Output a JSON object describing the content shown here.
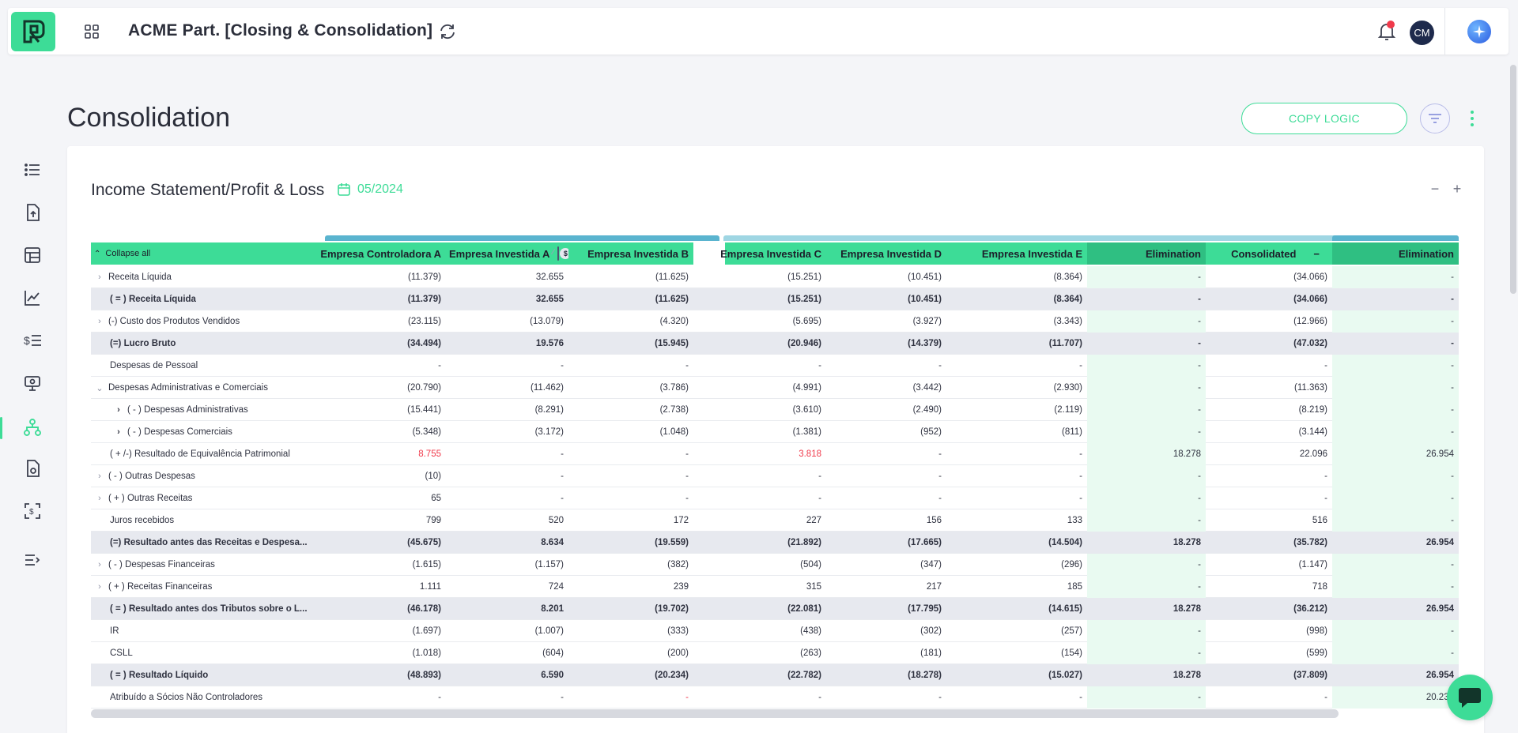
{
  "app": {
    "title": "ACME Part. [Closing & Consolidation]",
    "avatar_initials": "CM"
  },
  "page": {
    "title": "Consolidation",
    "copy_logic_label": "COPY LOGIC"
  },
  "card": {
    "title": "Income Statement/Profit & Loss",
    "date": "05/2024",
    "collapse_symbol": "−",
    "expand_symbol": "+"
  },
  "table": {
    "collapse_all_label": "Collapse all",
    "currency_toggle_symbol": "$",
    "currency_toggle_off_symbol": "⁄",
    "columns": [
      "Empresa Controladora A",
      "Empresa Investida A",
      "Empresa Investida B",
      "Empresa Investida C",
      "Empresa Investida D",
      "Empresa Investida E",
      "Elimination",
      "Consolidated",
      "Elimination"
    ],
    "consolidated_collapse_symbol": "−",
    "rows": [
      {
        "label": "Receita Líquida",
        "chevron": "›",
        "indent": 0,
        "bold": false,
        "values": [
          "(11.379)",
          "32.655",
          "(11.625)",
          "(15.251)",
          "(10.451)",
          "(8.364)",
          "-",
          "(34.066)",
          "-"
        ]
      },
      {
        "label": "( = ) Receita Líquida",
        "chevron": "",
        "indent": 1,
        "bold": true,
        "values": [
          "(11.379)",
          "32.655",
          "(11.625)",
          "(15.251)",
          "(10.451)",
          "(8.364)",
          "-",
          "(34.066)",
          "-"
        ]
      },
      {
        "label": "(-) Custo dos Produtos Vendidos",
        "chevron": "›",
        "indent": 0,
        "bold": false,
        "values": [
          "(23.115)",
          "(13.079)",
          "(4.320)",
          "(5.695)",
          "(3.927)",
          "(3.343)",
          "-",
          "(12.966)",
          "-"
        ]
      },
      {
        "label": "(=) Lucro Bruto",
        "chevron": "",
        "indent": 1,
        "bold": true,
        "values": [
          "(34.494)",
          "19.576",
          "(15.945)",
          "(20.946)",
          "(14.379)",
          "(11.707)",
          "-",
          "(47.032)",
          "-"
        ]
      },
      {
        "label": "Despesas de Pessoal",
        "chevron": "",
        "indent": 1,
        "bold": false,
        "values": [
          "-",
          "-",
          "-",
          "-",
          "-",
          "-",
          "-",
          "-",
          "-"
        ]
      },
      {
        "label": "Despesas Administrativas e Comerciais",
        "chevron": "⌄",
        "indent": 0,
        "bold": false,
        "values": [
          "(20.790)",
          "(11.462)",
          "(3.786)",
          "(4.991)",
          "(3.442)",
          "(2.930)",
          "-",
          "(11.363)",
          "-"
        ]
      },
      {
        "label": "( - ) Despesas Administrativas",
        "chevron": "›",
        "indent": 2,
        "bold": false,
        "values": [
          "(15.441)",
          "(8.291)",
          "(2.738)",
          "(3.610)",
          "(2.490)",
          "(2.119)",
          "-",
          "(8.219)",
          "-"
        ]
      },
      {
        "label": "( - ) Despesas Comerciais",
        "chevron": "›",
        "indent": 2,
        "bold": false,
        "values": [
          "(5.348)",
          "(3.172)",
          "(1.048)",
          "(1.381)",
          "(952)",
          "(811)",
          "-",
          "(3.144)",
          "-"
        ]
      },
      {
        "label": "( + /-) Resultado de Equivalência Patrimonial",
        "chevron": "",
        "indent": 1,
        "bold": false,
        "values": [
          "8.755",
          "-",
          "-",
          "3.818",
          "-",
          "-",
          "18.278",
          "22.096",
          "26.954"
        ],
        "red": [
          0,
          3
        ]
      },
      {
        "label": "( - ) Outras Despesas",
        "chevron": "›",
        "indent": 0,
        "bold": false,
        "values": [
          "(10)",
          "-",
          "-",
          "-",
          "-",
          "-",
          "-",
          "-",
          "-"
        ]
      },
      {
        "label": "( + ) Outras Receitas",
        "chevron": "›",
        "indent": 0,
        "bold": false,
        "values": [
          "65",
          "-",
          "-",
          "-",
          "-",
          "-",
          "-",
          "-",
          "-"
        ]
      },
      {
        "label": "Juros recebidos",
        "chevron": "",
        "indent": 1,
        "bold": false,
        "values": [
          "799",
          "520",
          "172",
          "227",
          "156",
          "133",
          "-",
          "516",
          "-"
        ]
      },
      {
        "label": "(=) Resultado antes das Receitas e Despesa...",
        "chevron": "",
        "indent": 1,
        "bold": true,
        "values": [
          "(45.675)",
          "8.634",
          "(19.559)",
          "(21.892)",
          "(17.665)",
          "(14.504)",
          "18.278",
          "(35.782)",
          "26.954"
        ]
      },
      {
        "label": "( - ) Despesas Financeiras",
        "chevron": "›",
        "indent": 0,
        "bold": false,
        "values": [
          "(1.615)",
          "(1.157)",
          "(382)",
          "(504)",
          "(347)",
          "(296)",
          "-",
          "(1.147)",
          "-"
        ]
      },
      {
        "label": "( + ) Receitas Financeiras",
        "chevron": "›",
        "indent": 0,
        "bold": false,
        "values": [
          "1.111",
          "724",
          "239",
          "315",
          "217",
          "185",
          "-",
          "718",
          "-"
        ]
      },
      {
        "label": "( = ) Resultado antes dos Tributos sobre o L...",
        "chevron": "",
        "indent": 1,
        "bold": true,
        "values": [
          "(46.178)",
          "8.201",
          "(19.702)",
          "(22.081)",
          "(17.795)",
          "(14.615)",
          "18.278",
          "(36.212)",
          "26.954"
        ]
      },
      {
        "label": "IR",
        "chevron": "",
        "indent": 1,
        "bold": false,
        "values": [
          "(1.697)",
          "(1.007)",
          "(333)",
          "(438)",
          "(302)",
          "(257)",
          "-",
          "(998)",
          "-"
        ]
      },
      {
        "label": "CSLL",
        "chevron": "",
        "indent": 1,
        "bold": false,
        "values": [
          "(1.018)",
          "(604)",
          "(200)",
          "(263)",
          "(181)",
          "(154)",
          "-",
          "(599)",
          "-"
        ]
      },
      {
        "label": "( = ) Resultado Líquido",
        "chevron": "",
        "indent": 1,
        "bold": true,
        "values": [
          "(48.893)",
          "6.590",
          "(20.234)",
          "(22.782)",
          "(18.278)",
          "(15.027)",
          "18.278",
          "(37.809)",
          "26.954"
        ]
      },
      {
        "label": "Atribuído a Sócios Não Controladores",
        "chevron": "",
        "indent": 1,
        "bold": false,
        "values": [
          "-",
          "-",
          "-",
          "-",
          "-",
          "-",
          "-",
          "-",
          "20.234"
        ],
        "red": [
          2
        ]
      }
    ]
  },
  "colors": {
    "accent": "#3ddc97",
    "accent_dark": "#2fbf82",
    "negative_red": "#f03a4b",
    "group_strip_1": "#5ab4cf",
    "group_strip_2": "#9fd6e3"
  },
  "icons": {
    "logo": "logo-icon",
    "apps": "grid-icon",
    "refresh": "refresh-icon",
    "bell": "bell-icon",
    "ai": "sparkle-icon",
    "calendar": "calendar-icon",
    "filter": "filter-icon",
    "chat": "chat-icon"
  }
}
